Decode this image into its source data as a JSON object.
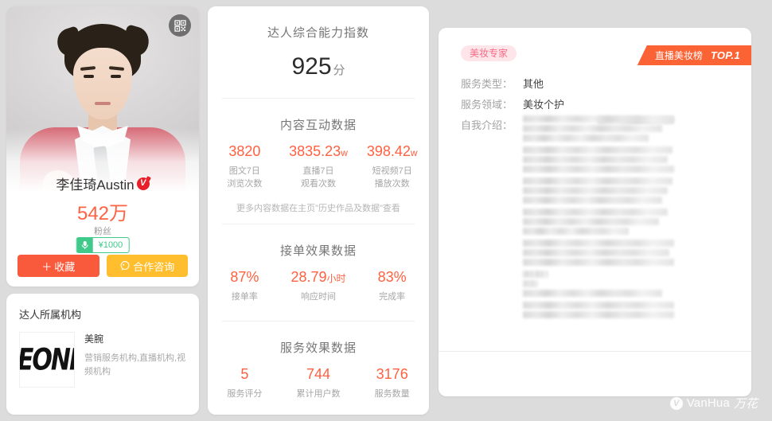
{
  "theme": {
    "page_bg": "#dcdcdc",
    "accent_red": "#ff6040",
    "accent_orange": "#fa5a3c",
    "accent_yellow": "#ffbe2e",
    "accent_green": "#3fc98a",
    "accent_pink": "#f96b85",
    "ribbon_orange": "#fb6234"
  },
  "profile": {
    "qr_icon": "qrcode-icon",
    "name": "李佳琦Austin",
    "verified_badge": "V",
    "fans_count": "542万",
    "fans_label": "粉丝",
    "price_icon": "microphone-icon",
    "price_value": "¥1000",
    "buttons": [
      {
        "icon": "plus-icon",
        "label": "收藏",
        "name": "favorite-button"
      },
      {
        "icon": "chat-icon",
        "label": "合作咨询",
        "name": "consult-button"
      }
    ]
  },
  "agency": {
    "title": "达人所属机构",
    "logo_text": "EONI",
    "name": "美腕",
    "desc": "营销服务机构,直播机构,视频机构"
  },
  "stats": {
    "score_section": {
      "title": "达人综合能力指数",
      "value": "925",
      "unit": "分"
    },
    "content_section": {
      "title": "内容互动数据",
      "items": [
        {
          "value": "3820",
          "unit": "",
          "label": "图文7日\n浏览次数",
          "label_l1": "图文7日",
          "label_l2": "浏览次数"
        },
        {
          "value": "3835.23",
          "unit": "w",
          "label_l1": "直播7日",
          "label_l2": "观看次数"
        },
        {
          "value": "398.42",
          "unit": "w",
          "label_l1": "短视频7日",
          "label_l2": "播放次数"
        }
      ],
      "hint": "更多内容数据在主页\"历史作品及数据\"查看"
    },
    "order_section": {
      "title": "接单效果数据",
      "items": [
        {
          "value": "87%",
          "unit": "",
          "label_l1": "接单率",
          "label_l2": ""
        },
        {
          "value": "28.79",
          "unit": "小时",
          "label_l1": "响应时间",
          "label_l2": ""
        },
        {
          "value": "83%",
          "unit": "",
          "label_l1": "完成率",
          "label_l2": ""
        }
      ]
    },
    "service_section": {
      "title": "服务效果数据",
      "items": [
        {
          "value": "5",
          "unit": "",
          "label_l1": "服务评分",
          "label_l2": ""
        },
        {
          "value": "744",
          "unit": "",
          "label_l1": "累计用户数",
          "label_l2": ""
        },
        {
          "value": "3176",
          "unit": "",
          "label_l1": "服务数量",
          "label_l2": ""
        }
      ]
    }
  },
  "detail": {
    "expert_tag": "美妆专家",
    "ribbon_label": "直播美妆榜",
    "ribbon_rank": "TOP.1",
    "fields": [
      {
        "label": "服务类型：",
        "value": "其他"
      },
      {
        "label": "服务领域：",
        "value": "美妆个护"
      },
      {
        "label": "自我介绍：",
        "value": ""
      }
    ],
    "intro_redacted": true
  },
  "watermark": {
    "logo": "v-logo-icon",
    "text": "VanHua",
    "text_cn": "万花"
  }
}
